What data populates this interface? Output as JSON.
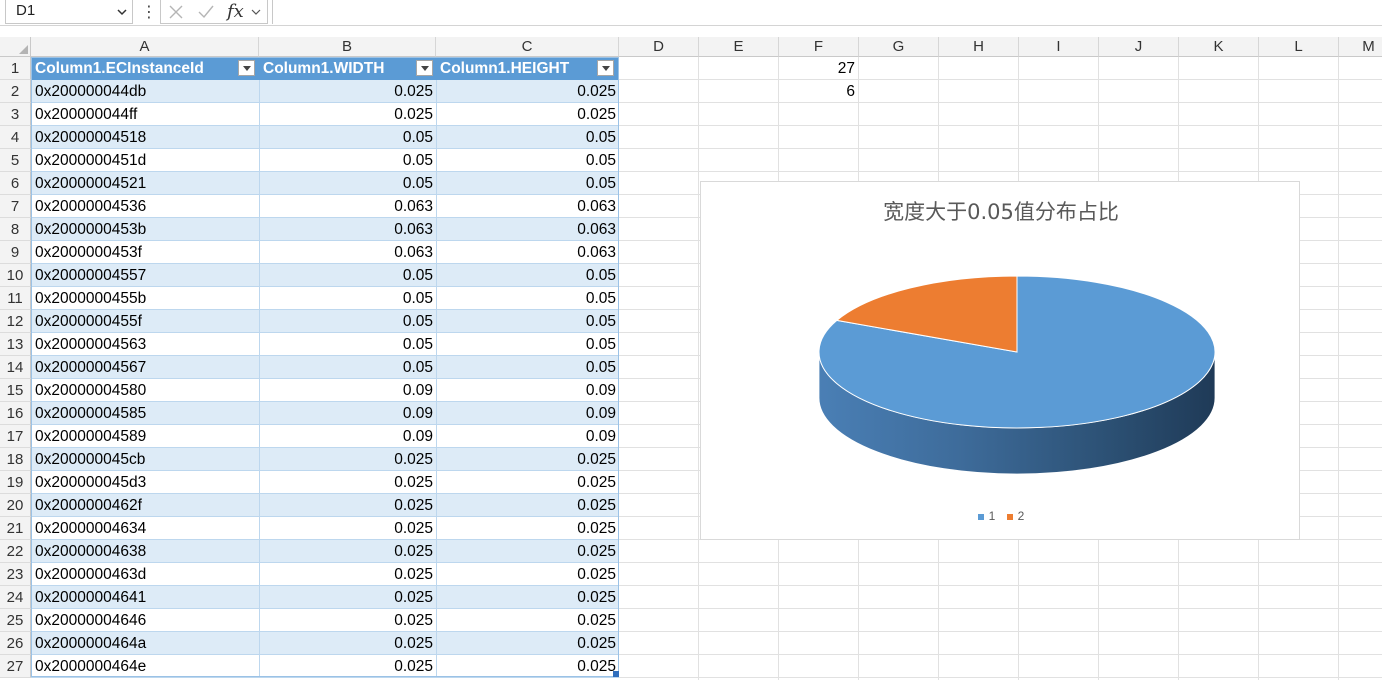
{
  "formula_bar": {
    "name_box": "D1",
    "fx_label": "fx",
    "formula": ""
  },
  "columns": [
    "A",
    "B",
    "C",
    "D",
    "E",
    "F",
    "G",
    "H",
    "I",
    "J",
    "K",
    "L",
    "M"
  ],
  "rows": [
    "1",
    "2",
    "3",
    "4",
    "5",
    "6",
    "7",
    "8",
    "9",
    "10",
    "11",
    "12",
    "13",
    "14",
    "15",
    "16",
    "17",
    "18",
    "19",
    "20",
    "21",
    "22",
    "23",
    "24",
    "25",
    "26",
    "27"
  ],
  "table": {
    "headers": [
      "Column1.ECInstanceId",
      "Column1.WIDTH",
      "Column1.HEIGHT"
    ],
    "rows": [
      [
        "0x200000044db",
        "0.025",
        "0.025"
      ],
      [
        "0x200000044ff",
        "0.025",
        "0.025"
      ],
      [
        "0x20000004518",
        "0.05",
        "0.05"
      ],
      [
        "0x2000000451d",
        "0.05",
        "0.05"
      ],
      [
        "0x20000004521",
        "0.05",
        "0.05"
      ],
      [
        "0x20000004536",
        "0.063",
        "0.063"
      ],
      [
        "0x2000000453b",
        "0.063",
        "0.063"
      ],
      [
        "0x2000000453f",
        "0.063",
        "0.063"
      ],
      [
        "0x20000004557",
        "0.05",
        "0.05"
      ],
      [
        "0x2000000455b",
        "0.05",
        "0.05"
      ],
      [
        "0x2000000455f",
        "0.05",
        "0.05"
      ],
      [
        "0x20000004563",
        "0.05",
        "0.05"
      ],
      [
        "0x20000004567",
        "0.05",
        "0.05"
      ],
      [
        "0x20000004580",
        "0.09",
        "0.09"
      ],
      [
        "0x20000004585",
        "0.09",
        "0.09"
      ],
      [
        "0x20000004589",
        "0.09",
        "0.09"
      ],
      [
        "0x200000045cb",
        "0.025",
        "0.025"
      ],
      [
        "0x200000045d3",
        "0.025",
        "0.025"
      ],
      [
        "0x2000000462f",
        "0.025",
        "0.025"
      ],
      [
        "0x20000004634",
        "0.025",
        "0.025"
      ],
      [
        "0x20000004638",
        "0.025",
        "0.025"
      ],
      [
        "0x2000000463d",
        "0.025",
        "0.025"
      ],
      [
        "0x20000004641",
        "0.025",
        "0.025"
      ],
      [
        "0x20000004646",
        "0.025",
        "0.025"
      ],
      [
        "0x2000000464a",
        "0.025",
        "0.025"
      ],
      [
        "0x2000000464e",
        "0.025",
        "0.025"
      ]
    ]
  },
  "column_f": {
    "F1": "27",
    "F2": "6"
  },
  "colors": {
    "header_blue": "#5b9bd5",
    "band_blue": "#ddebf7",
    "slice1": "#5b9bd5",
    "slice2": "#ed7d31"
  },
  "chart_data": {
    "type": "pie",
    "title": "宽度大于0.05值分布占比",
    "categories": [
      "1",
      "2"
    ],
    "values": [
      27,
      6
    ],
    "legend_position": "bottom",
    "style": "3d"
  }
}
